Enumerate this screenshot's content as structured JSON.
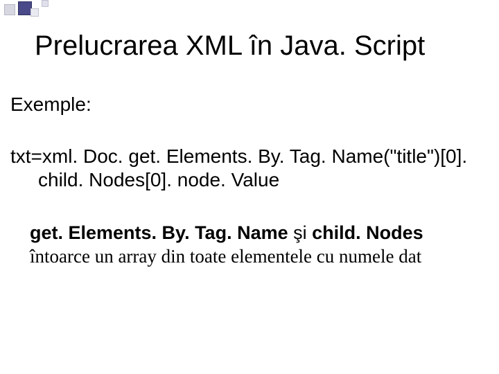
{
  "title": "Prelucrarea XML în Java. Script",
  "exemple_label": "Exemple:",
  "code": {
    "line1": "txt=xml. Doc. get. Elements. By. Tag. Name(\"title\")[0].",
    "line2": "child. Nodes[0]. node. Value"
  },
  "desc": {
    "bold1": "get. Elements. By. Tag. Name",
    "mid": " şi ",
    "bold2": "child. Nodes",
    "line2": "întoarce un array din toate elementele cu numele dat"
  }
}
